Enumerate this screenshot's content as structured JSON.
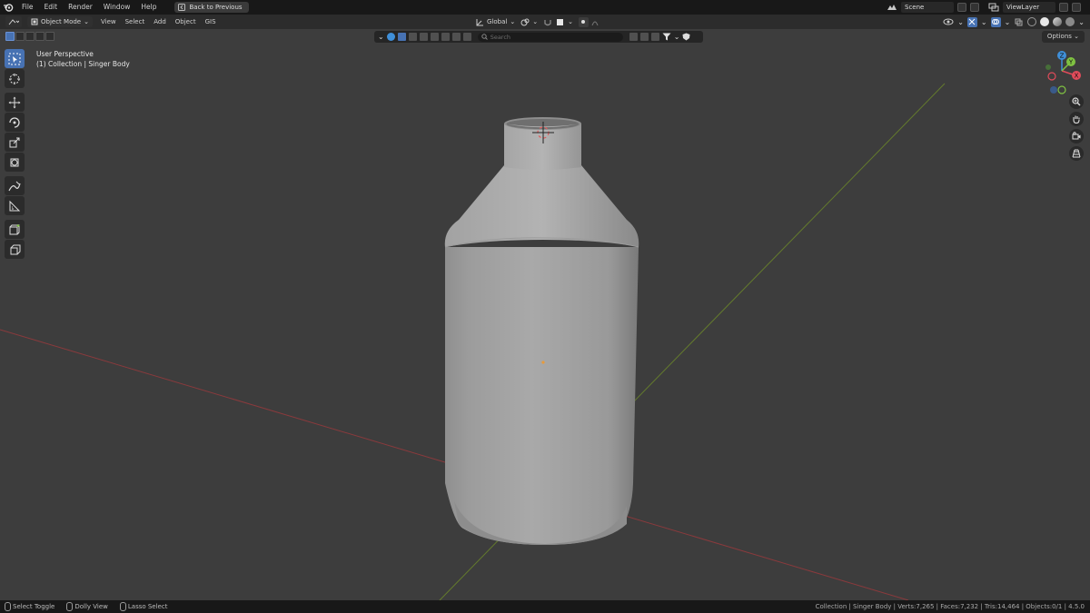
{
  "topbar": {
    "menus": [
      "File",
      "Edit",
      "Render",
      "Window",
      "Help"
    ],
    "back_button": "Back to Previous",
    "scene_label": "Scene",
    "view_layer_label": "ViewLayer"
  },
  "header": {
    "mode": "Object Mode",
    "menus": [
      "View",
      "Select",
      "Add",
      "Object",
      "GIS"
    ],
    "orientation": "Global"
  },
  "outliner_strip": {
    "search_placeholder": "Search"
  },
  "options_label": "Options",
  "viewport": {
    "perspective": "User Perspective",
    "collection_info": "(1) Collection | Singer Body"
  },
  "gizmo": {
    "x_label": "X",
    "y_label": "Y",
    "z_label": "Z",
    "colors": {
      "x": "#e04b5a",
      "y": "#7fc242",
      "z": "#3f8fd9"
    }
  },
  "toolbar": {
    "tools": [
      "select-box",
      "cursor",
      "move",
      "rotate",
      "scale",
      "transform",
      "annotate",
      "measure",
      "add-cube",
      "extrude"
    ]
  },
  "statusbar": {
    "hint_select": "Select Toggle",
    "hint_dolly": "Dolly View",
    "hint_lasso": "Lasso Select",
    "stats": "Collection | Singer Body | Verts:7,265 | Faces:7,232 | Tris:14,464 | Objects:0/1 | 4.5.0"
  },
  "colors": {
    "accent": "#4772b3",
    "viewport_bg": "#3d3d3d",
    "axis_x": "#9b3a3a",
    "axis_y": "#6e8a2c"
  }
}
